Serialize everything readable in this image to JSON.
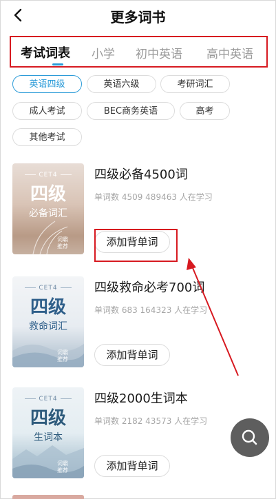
{
  "header": {
    "title": "更多词书",
    "back_icon": "chevron-left-icon"
  },
  "tabs": [
    {
      "label": "考试词表",
      "active": true
    },
    {
      "label": "小学",
      "active": false
    },
    {
      "label": "初中英语",
      "active": false
    },
    {
      "label": "高中英语",
      "active": false
    }
  ],
  "chips": [
    {
      "label": "英语四级",
      "active": true
    },
    {
      "label": "英语六级",
      "active": false
    },
    {
      "label": "考研词汇",
      "active": false
    },
    {
      "label": "成人考试",
      "active": false
    },
    {
      "label": "BEC商务英语",
      "active": false
    },
    {
      "label": "高考",
      "active": false
    },
    {
      "label": "其他考试",
      "active": false
    }
  ],
  "books": [
    {
      "cover_tag": "CET4",
      "cover_big": "四级",
      "cover_sub": "必备词汇",
      "cover_stamp": "词霸推荐",
      "title": "四级必备4500词",
      "meta": "单词数 4509  489463 人在学习",
      "button": "添加背单词"
    },
    {
      "cover_tag": "CET4",
      "cover_big": "四级",
      "cover_sub": "救命词汇",
      "cover_stamp": "词霸推荐",
      "title": "四级救命必考700词",
      "meta": "单词数 683  164323 人在学习",
      "button": "添加背单词"
    },
    {
      "cover_tag": "CET4",
      "cover_big": "四级",
      "cover_sub": "生词本",
      "cover_stamp": "词霸推荐",
      "title": "四级2000生词本",
      "meta": "单词数 2182  43573 人在学习",
      "button": "添加背单词"
    }
  ],
  "fab": {
    "icon": "search-icon"
  },
  "colors": {
    "accent": "#2b9bd8",
    "annotation_red": "#d71920",
    "fab": "#5e5e5e"
  }
}
